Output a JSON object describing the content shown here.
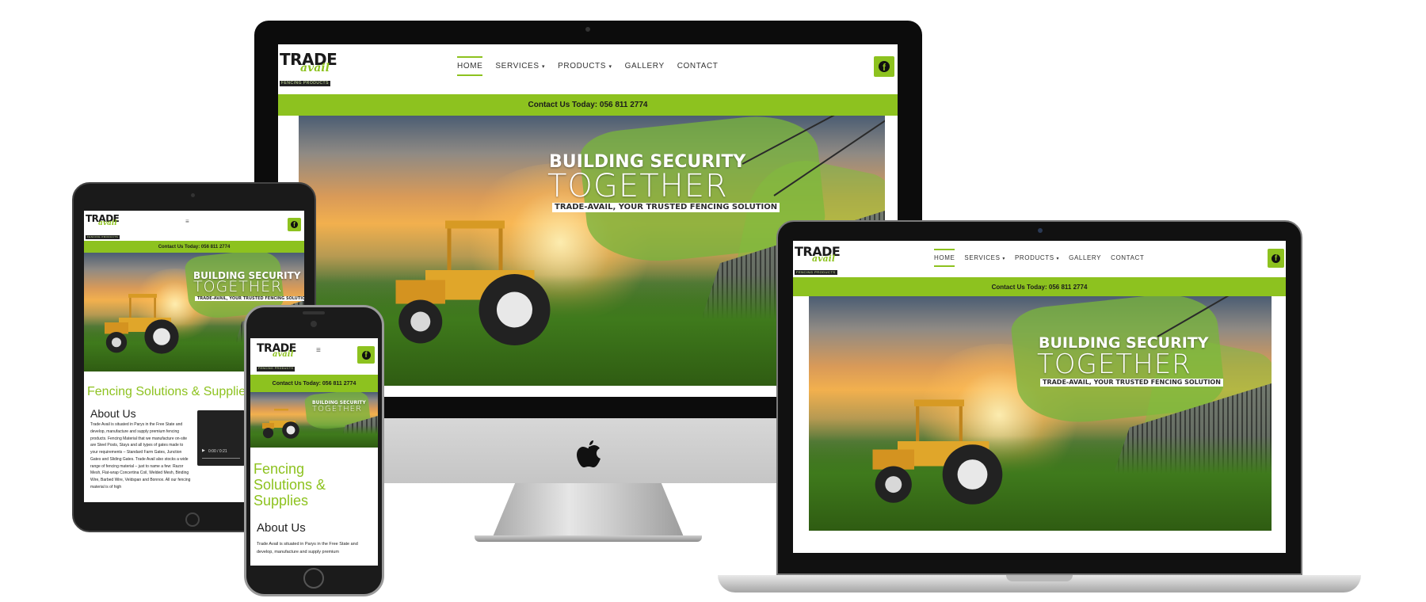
{
  "site": {
    "brand": {
      "logo_text_main": "TRADE",
      "logo_text_script": "avail",
      "logo_text_tag": "FENCING PRODUCTS"
    },
    "nav": [
      {
        "label": "HOME",
        "active": true
      },
      {
        "label": "SERVICES",
        "has_dropdown": true
      },
      {
        "label": "PRODUCTS",
        "has_dropdown": true
      },
      {
        "label": "GALLERY"
      },
      {
        "label": "CONTACT"
      }
    ],
    "contact_bar": "Contact Us Today: 056 811 2774",
    "hero": {
      "title_line1": "BUILDING SECURITY",
      "title_line2": "TOGETHER",
      "tagline": "TRADE-AVAIL, YOUR TRUSTED FENCING SOLUTION"
    },
    "section_title": "Fencing Solutions & Suppliers",
    "section_title_phone": "Fencing Solutions & Supplies",
    "about_title": "About Us",
    "about_text_tablet": "Trade Avail is situated in Parys in the Free State and develop, manufacture and supply premium fencing products. Fencing Material that we manufacture on-site are Steel Posts, Stays and all types of gates made to your requirements – Standard Farm Gates, Junction Gates and Sliding Gates. Trade Avail also stocks a wide range of fencing material – just to name a few: Razor Mesh, Flat-wrap Concertina Coil, Welded Mesh, Binding Wire, Barbed Wire, Veldspan and Bonnox. All our fencing material is of high",
    "about_text_phone": "Trade Avail is situated in Parys in the Free State and develop, manufacture and supply premium",
    "video": {
      "time": "0:00 / 0:21"
    },
    "icons": {
      "facebook": "facebook-icon",
      "dropdown": "chevron-down-icon",
      "menu": "hamburger-menu-icon",
      "play": "play-icon"
    },
    "colors": {
      "accent": "#8dc21f",
      "text_dark": "#222222",
      "header_bg": "#ffffff"
    }
  }
}
